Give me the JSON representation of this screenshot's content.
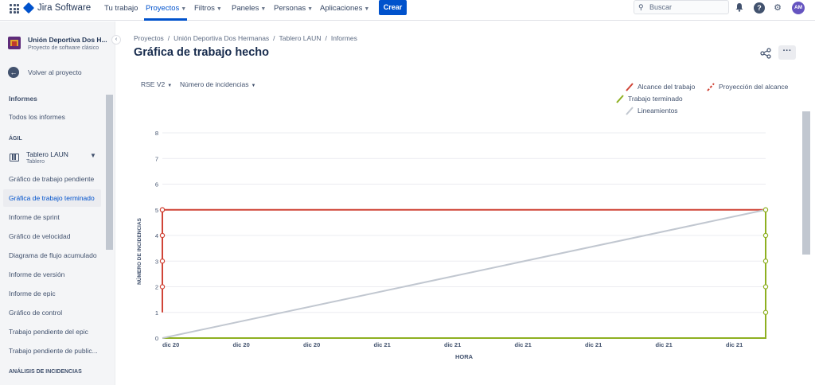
{
  "topnav": {
    "brand": "Jira Software",
    "items": [
      {
        "label": "Tu trabajo",
        "dropdown": false
      },
      {
        "label": "Proyectos",
        "dropdown": true,
        "active": true
      },
      {
        "label": "Filtros",
        "dropdown": true
      },
      {
        "label": "Paneles",
        "dropdown": true
      },
      {
        "label": "Personas",
        "dropdown": true
      },
      {
        "label": "Aplicaciones",
        "dropdown": true
      }
    ],
    "create_label": "Crear",
    "search_placeholder": "Buscar",
    "avatar_initials": "AM",
    "accent": "#0052cc"
  },
  "sidebar": {
    "project_name": "Unión Deportiva Dos H...",
    "project_type": "Proyecto de software clásico",
    "back_label": "Volver al proyecto",
    "reports_heading": "Informes",
    "all_reports": "Todos los informes",
    "agile_heading": "ÁGIL",
    "board_name": "Tablero LAUN",
    "board_type": "Tablero",
    "reports": [
      "Gráfico de trabajo pendiente",
      "Gráfica de trabajo terminado",
      "Informe de sprint",
      "Gráfico de velocidad",
      "Diagrama de flujo acumulado",
      "Informe de versión",
      "Informe de epic",
      "Gráfico de control",
      "Trabajo pendiente del epic",
      "Trabajo pendiente de public..."
    ],
    "active_report_index": 1,
    "analysis_heading": "ANÁLISIS DE INCIDENCIAS"
  },
  "main": {
    "breadcrumbs": [
      "Proyectos",
      "Unión Deportiva Dos Hermanas",
      "Tablero LAUN",
      "Informes"
    ],
    "title": "Gráfica de trabajo hecho",
    "filters": {
      "release": "RSE V2",
      "measure": "Número de incidencias"
    }
  },
  "chart_data": {
    "type": "line",
    "xlabel": "HORA",
    "ylabel": "NÚMERO DE INCIDENCIAS",
    "ylim": [
      0,
      8
    ],
    "y_ticks": [
      0,
      1,
      2,
      3,
      4,
      5,
      6,
      7,
      8
    ],
    "x_tick_labels": [
      "dic 20",
      "dic 20",
      "dic 20",
      "dic 21",
      "dic 21",
      "dic 21",
      "dic 21",
      "dic 21",
      "dic 21"
    ],
    "grid": true,
    "legend_placement": "top-right",
    "legend": [
      {
        "label": "Alcance del trabajo",
        "color": "#d04437",
        "style": "solid"
      },
      {
        "label": "Proyección del alcance",
        "color": "#d04437",
        "style": "dashed"
      },
      {
        "label": "Trabajo terminado",
        "color": "#8eb021",
        "style": "solid"
      },
      {
        "label": "Lineamientos",
        "color": "#c1c7d0",
        "style": "solid"
      }
    ],
    "series": [
      {
        "name": "Alcance del trabajo",
        "color": "#d04437",
        "x": [
          0,
          0,
          1
        ],
        "y": [
          1,
          5,
          5
        ],
        "markers_at": [
          0,
          0,
          0,
          0
        ],
        "marker_y": [
          2,
          3,
          4,
          5
        ]
      },
      {
        "name": "Trabajo terminado",
        "color": "#8eb021",
        "x": [
          0,
          1,
          1
        ],
        "y": [
          0,
          0,
          5
        ],
        "marker_y": [
          1,
          2,
          3,
          4,
          5
        ]
      },
      {
        "name": "Lineamientos",
        "color": "#c1c7d0",
        "x": [
          0,
          1
        ],
        "y": [
          0,
          5
        ]
      }
    ]
  }
}
